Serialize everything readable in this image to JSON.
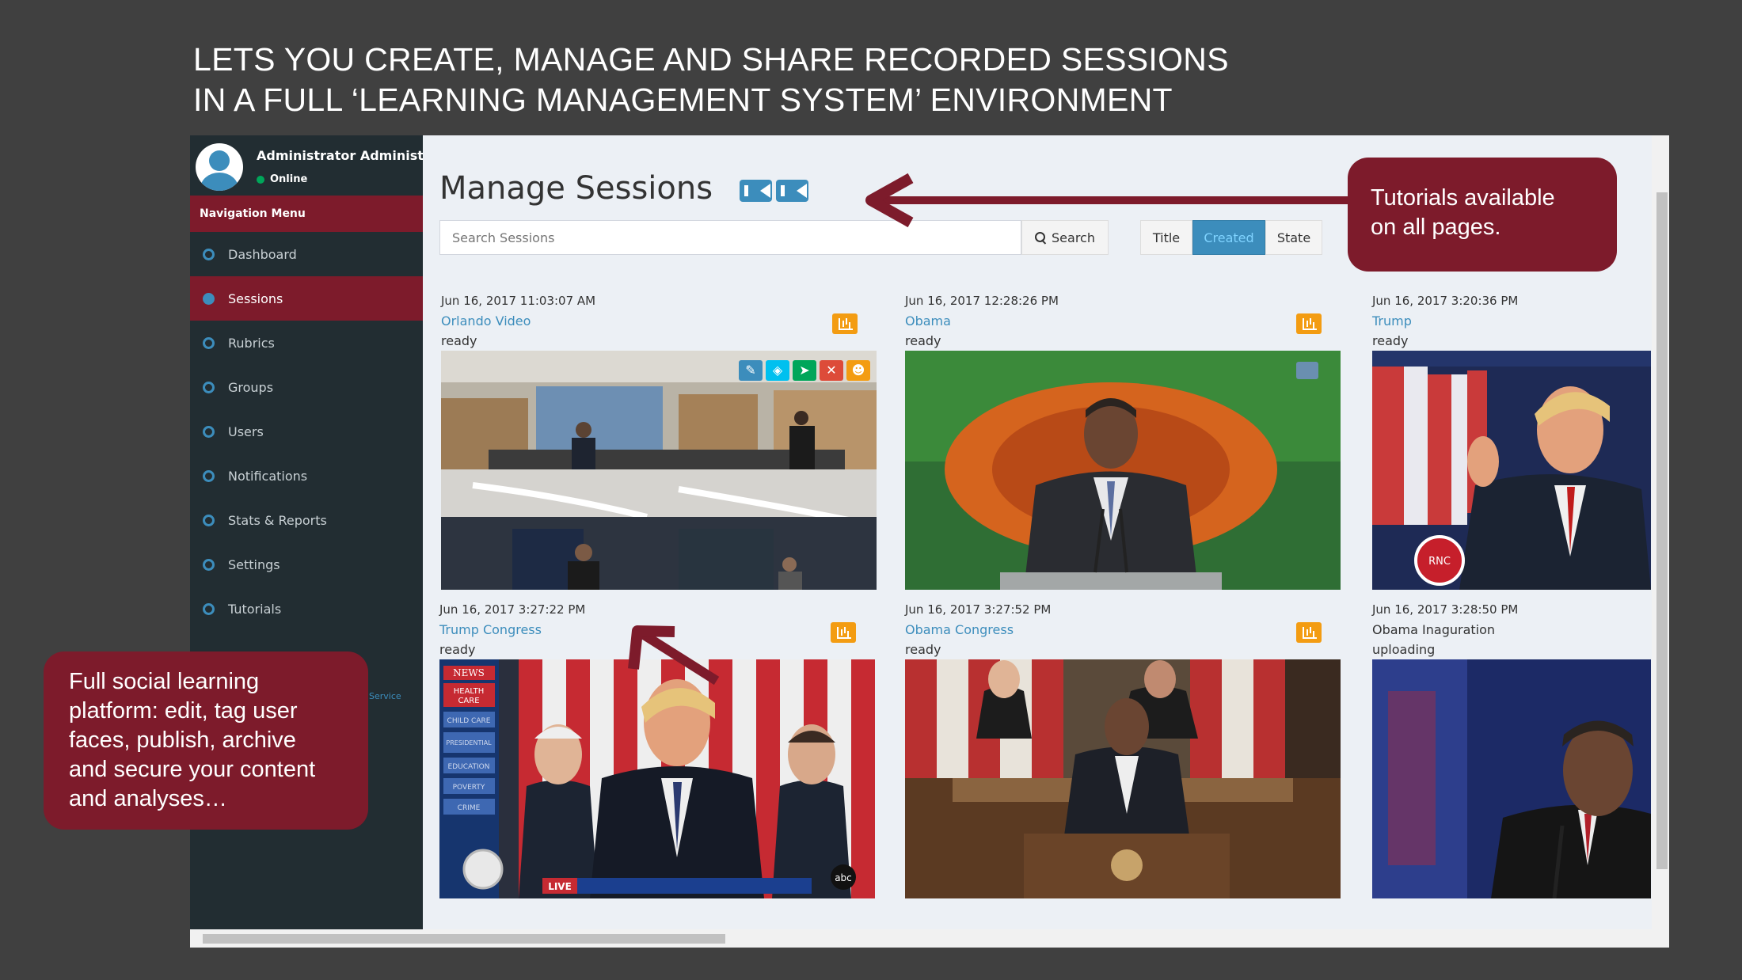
{
  "headline": {
    "line1": "LETS YOU CREATE, MANAGE AND SHARE RECORDED SESSIONS",
    "line2": "IN A FULL ‘LEARNING MANAGEMENT SYSTEM’ ENVIRONMENT"
  },
  "user": {
    "name": "Administrator Administrator",
    "status": "Online"
  },
  "sidebar": {
    "header": "Navigation Menu",
    "items": [
      {
        "label": "Dashboard",
        "active": false
      },
      {
        "label": "Sessions",
        "active": true
      },
      {
        "label": "Rubrics",
        "active": false
      },
      {
        "label": "Groups",
        "active": false
      },
      {
        "label": "Users",
        "active": false
      },
      {
        "label": "Notifications",
        "active": false
      },
      {
        "label": "Stats & Reports",
        "active": false
      },
      {
        "label": "Settings",
        "active": false
      },
      {
        "label": "Tutorials",
        "active": false
      }
    ],
    "footer_text": "Service"
  },
  "main": {
    "title": "Manage Sessions",
    "search": {
      "placeholder": "Search Sessions",
      "button_label": "Search"
    },
    "sort": {
      "options": [
        "Title",
        "Created",
        "State"
      ],
      "selected": "Created"
    }
  },
  "sessions": [
    {
      "date": "Jun 16, 2017 11:03:07 AM",
      "title": "Orlando Video",
      "state": "ready"
    },
    {
      "date": "Jun 16, 2017 12:28:26 PM",
      "title": "Obama",
      "state": "ready"
    },
    {
      "date": "Jun 16, 2017 3:20:36 PM",
      "title": "Trump",
      "state": "ready"
    },
    {
      "date": "Jun 16, 2017 3:27:22 PM",
      "title": "Trump Congress",
      "state": "ready"
    },
    {
      "date": "Jun 16, 2017 3:27:52 PM",
      "title": "Obama Congress",
      "state": "ready"
    },
    {
      "date": "Jun 16, 2017 3:28:50 PM",
      "title": "Obama Inaguration",
      "state": "uploading"
    }
  ],
  "thumb_toolbar": [
    "edit-icon",
    "tag-icon",
    "publish-icon",
    "delete-icon",
    "faces-icon"
  ],
  "callouts": {
    "tutorials": [
      "Tutorials available",
      "on all pages."
    ],
    "social": [
      "Full social learning",
      "platform: edit, tag user",
      "faces, publish, archive",
      "and secure your content",
      "and analyses…"
    ]
  },
  "colors": {
    "accent": "#3c8dbc",
    "brand": "#7d1b2b",
    "sidebar": "#222d32",
    "stats": "#f39c12"
  }
}
